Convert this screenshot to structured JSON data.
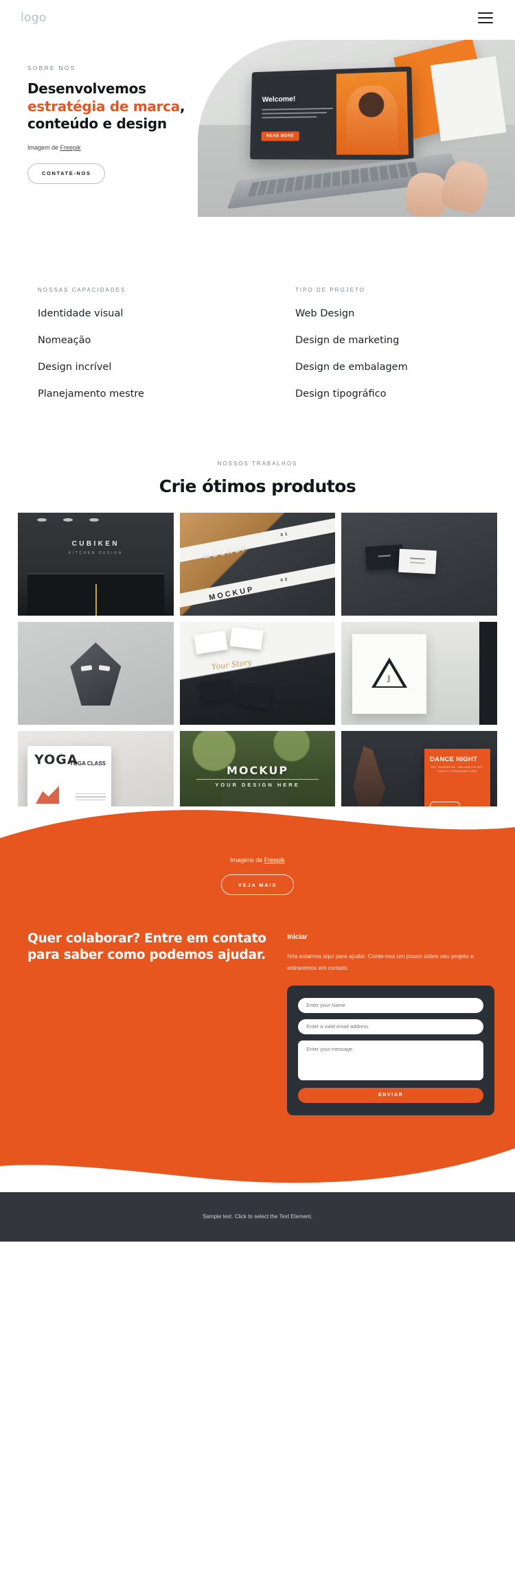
{
  "header": {
    "logo": "logo",
    "menu_icon": "hamburger-menu-icon"
  },
  "hero": {
    "eyebrow": "SOBRE NÓS",
    "title_part1": "Desenvolvemos ",
    "title_accent1": "estratégia de marca",
    "title_part2": ", conteúdo e design",
    "credit_prefix": "Imagem de ",
    "credit_link": "Freepik",
    "cta_label": "CONTATE-NOS",
    "screen_welcome": "Welcome!",
    "screen_button": "READ MORE"
  },
  "capabilities": {
    "columns": [
      {
        "heading": "NOSSAS CAPACIDADES",
        "items": [
          "Identidade visual",
          "Nomeação",
          "Design incrível",
          "Planejamento mestre"
        ]
      },
      {
        "heading": "TIPO DE PROJETO",
        "items": [
          "Web Design",
          "Design de marketing",
          "Design de embalagem",
          "Design tipográfico"
        ]
      }
    ]
  },
  "works": {
    "eyebrow": "NOSSOS TRABALHOS",
    "title": "Crie ótimos produtos",
    "tiles": [
      {
        "name": "cubiken-storefront",
        "brand": "CUBIKEN",
        "sub": "KITCHEN DESIGN"
      },
      {
        "name": "mockup-cards-wood",
        "band1": "01",
        "band2": "02",
        "word1": "MOCKUP",
        "word2": "MOCKUP"
      },
      {
        "name": "dark-business-cards"
      },
      {
        "name": "grey-mask-sculpture"
      },
      {
        "name": "scattered-cards",
        "signature": "Your Story"
      },
      {
        "name": "triangle-poster",
        "monogram": "J"
      },
      {
        "name": "yoga-class-tablet",
        "word": "YOGA",
        "label": "YOGA CLASS"
      },
      {
        "name": "storefront-window-mockup",
        "word": "MOCKUP",
        "sub": "YOUR DESIGN HERE"
      },
      {
        "name": "dance-night-flyer",
        "word": "DANCE NIGHT",
        "sub": "SAT IMMERSIVE. ORLANDO'S APT. JOIN 27 NOVEMBER 2020"
      }
    ],
    "credit_prefix": "Imagens de ",
    "credit_link": "Freepik",
    "more_label": "VEJA MAIS"
  },
  "contact": {
    "title": "Quer colaborar? Entre em contato para saber como podemos ajudar.",
    "start_heading": "Iniciar",
    "start_copy": "Nós estamos aqui para ajudar. Conte-nos um pouco sobre seu projeto e entraremos em contato.",
    "form": {
      "name_placeholder": "Enter your Name",
      "name_value": "",
      "email_placeholder": "Enter a valid email address",
      "email_value": "",
      "message_placeholder": "Enter your message",
      "message_value": "",
      "submit_label": "ENVIAR"
    }
  },
  "footer": {
    "text": "Sample text. Click to select the Text Element."
  },
  "colors": {
    "accent": "#e8561f",
    "dark": "#33373d",
    "form_card": "#2b2f36"
  }
}
